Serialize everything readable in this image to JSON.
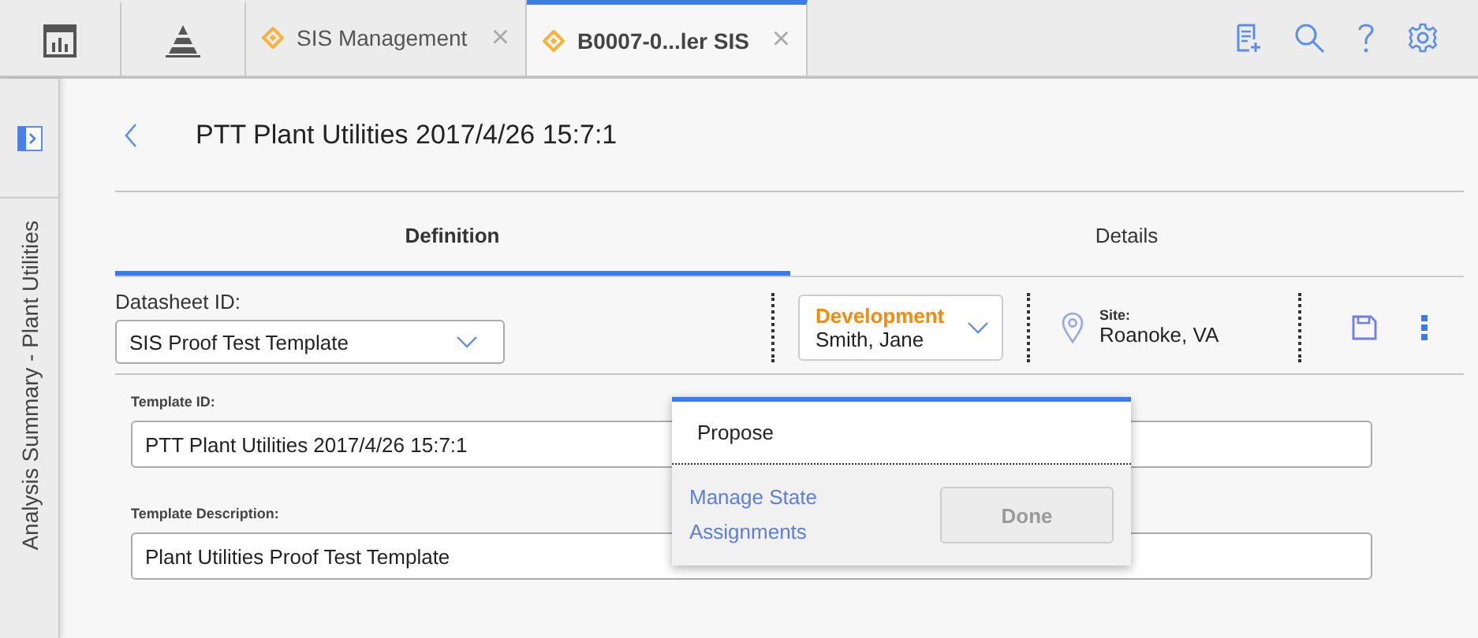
{
  "app_tabs": [
    {
      "kind": "icon",
      "selected": false
    },
    {
      "kind": "icon",
      "selected": false
    },
    {
      "kind": "doc",
      "label": "SIS Management",
      "close": "×",
      "selected": false
    },
    {
      "kind": "doc",
      "label": "B0007-0...ler SIS",
      "close": "×",
      "selected": true
    }
  ],
  "sidebar": {
    "label": "Analysis Summary - Plant Utilities"
  },
  "page": {
    "title": "PTT Plant Utilities 2017/4/26 15:7:1"
  },
  "tabs": [
    {
      "label": "Definition",
      "selected": true
    },
    {
      "label": "Details",
      "selected": false
    }
  ],
  "datasheet": {
    "label": "Datasheet ID:",
    "value": "SIS Proof Test Template"
  },
  "state": {
    "name": "Development",
    "owner": "Smith, Jane"
  },
  "site": {
    "label": "Site:",
    "value": "Roanoke, VA"
  },
  "fields": [
    {
      "label": "Template ID:",
      "value": "PTT Plant Utilities 2017/4/26 15:7:1"
    },
    {
      "label": "Template Description:",
      "value": "Plant Utilities Proof Test Template"
    }
  ],
  "popup": {
    "options": [
      "Propose"
    ],
    "link": "Manage State Assignments",
    "button": {
      "label": "Done",
      "disabled": true
    }
  }
}
